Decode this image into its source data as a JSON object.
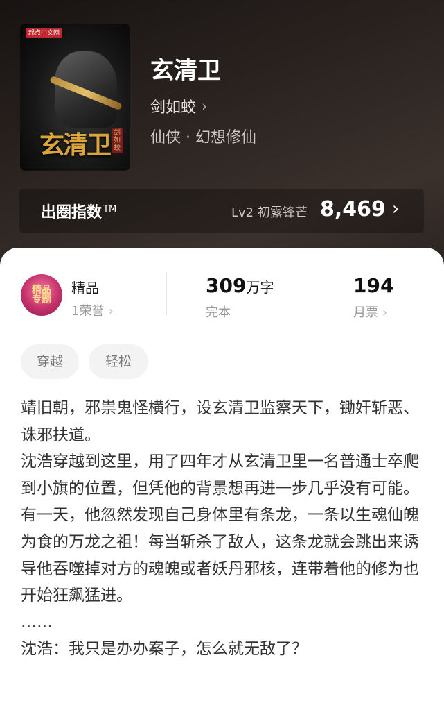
{
  "book": {
    "cover_badge": "起点中文网",
    "cover_title": "玄清卫",
    "cover_author": "剑如蛟",
    "title": "玄清卫",
    "author": "剑如蛟",
    "category": "仙侠 · 幻想修仙"
  },
  "index": {
    "label": "出圈指数",
    "tm": "TM",
    "level": "Lv2 初露锋芒",
    "value": "8,469"
  },
  "stats": {
    "badge_text": "精品\n专题",
    "quality_title": "精品",
    "honor": "1荣誉",
    "words_num": "309",
    "words_unit": "万字",
    "status": "完本",
    "votes": "194",
    "votes_label": "月票"
  },
  "tags": [
    "穿越",
    "轻松"
  ],
  "synopsis": [
    "靖旧朝，邪祟鬼怪横行，设玄清卫监察天下，锄奸斩恶、诛邪扶道。",
    "沈浩穿越到这里，用了四年才从玄清卫里一名普通士卒爬到小旗的位置，但凭他的背景想再进一步几乎没有可能。",
    "有一天，他忽然发现自己身体里有条龙，一条以生魂仙魄为食的万龙之祖！每当斩杀了敌人，这条龙就会跳出来诱导他吞噬掉对方的魂魄或者妖丹邪核，连带着他的修为也开始狂飙猛进。",
    "……",
    "沈浩：我只是办办案子，怎么就无敌了？"
  ],
  "icons": {
    "chevron": "chevron-right-icon",
    "badge": "quality-badge-icon"
  }
}
